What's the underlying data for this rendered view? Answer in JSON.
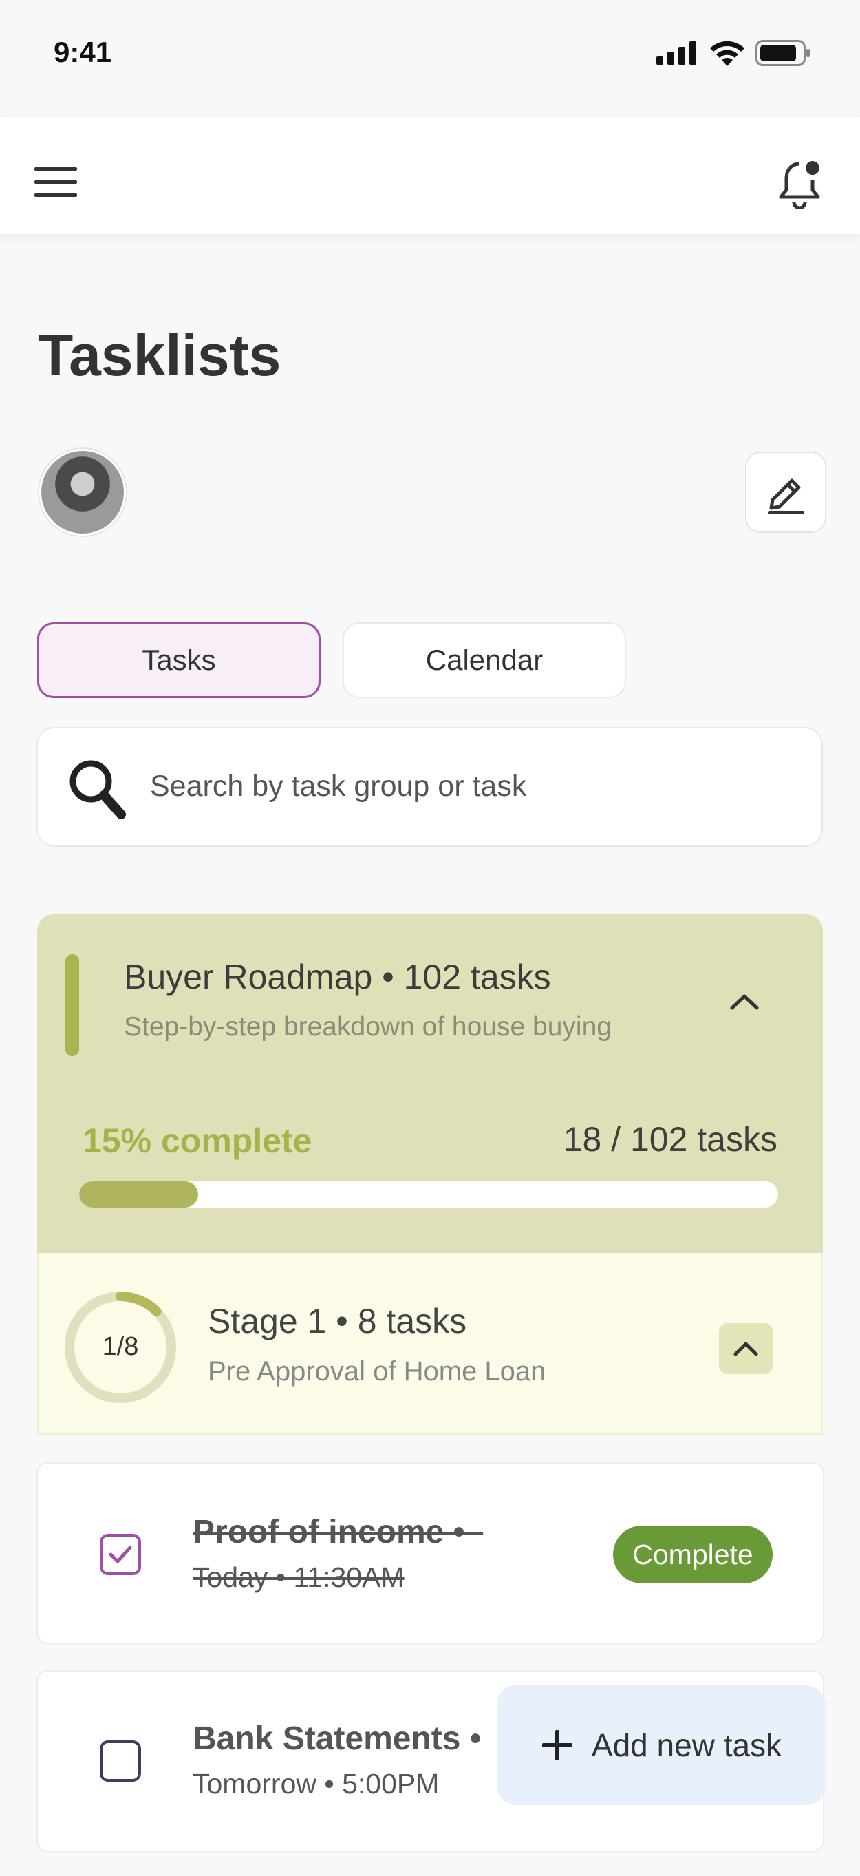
{
  "status_bar": {
    "time": "9:41"
  },
  "page": {
    "title": "Tasklists"
  },
  "tabs": [
    {
      "label": "Tasks",
      "active": true
    },
    {
      "label": "Calendar",
      "active": false
    }
  ],
  "search": {
    "placeholder": "Search by task group or task"
  },
  "roadmap": {
    "title": "Buyer Roadmap",
    "task_count": "102 tasks",
    "subtitle": "Step-by-step breakdown of house buying",
    "percent_label": "15%",
    "complete_label": "complete",
    "progress_fraction": 0.17,
    "done_count": "18 / 102 tasks"
  },
  "stage": {
    "title": "Stage 1",
    "task_count": "8 tasks",
    "subtitle": "Pre Approval of Home Loan",
    "ring_label": "1/8",
    "progress_fraction": 0.125
  },
  "tasks": [
    {
      "title": "Proof of income",
      "meta": "Today • 11:30AM",
      "checked": true,
      "badge": "Complete"
    },
    {
      "title": "Bank Statements",
      "meta": "Tomorrow • 5:00PM",
      "checked": false
    }
  ],
  "add_task": {
    "label": "Add new task"
  },
  "colors": {
    "accent_purple": "#a14ea6",
    "roadmap_bg": "#e0e0b8",
    "progress_green": "#aeb55c",
    "complete_green": "#6a9a37",
    "add_task_bg": "#e8f0fb"
  },
  "icons": [
    "signal-icon",
    "wifi-icon",
    "battery-icon",
    "menu-icon",
    "bell-icon",
    "edit-icon",
    "search-icon",
    "chevron-up-icon",
    "check-icon",
    "plus-icon"
  ]
}
